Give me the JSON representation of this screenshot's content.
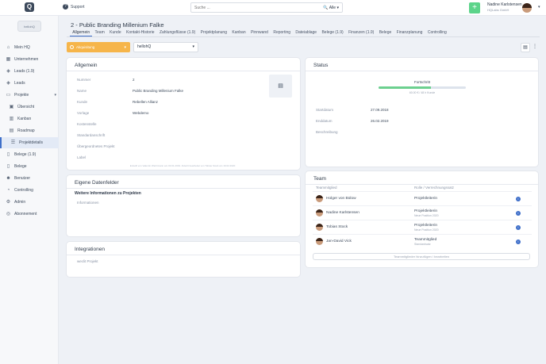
{
  "app": {
    "logo_letter": "Q",
    "workspace_label": "hellohQ"
  },
  "topbar": {
    "support_label": "Support",
    "search_placeholder": "Suche ...",
    "search_scope": "Alle",
    "add_symbol": "+",
    "user_name": "Nadine Karlstensen",
    "user_org": "HQLabs GmbH"
  },
  "sidebar": {
    "items": [
      {
        "label": "Mein HQ",
        "icon": "home-icon"
      },
      {
        "label": "Unternehmen",
        "icon": "building-icon"
      },
      {
        "label": "Leads (1.9)",
        "icon": "tag-icon"
      },
      {
        "label": "Leads",
        "icon": "tag-icon"
      },
      {
        "label": "Projekte",
        "icon": "folder-icon"
      },
      {
        "label": "Übersicht",
        "icon": "overview-icon"
      },
      {
        "label": "Kanban",
        "icon": "kanban-icon"
      },
      {
        "label": "Roadmap",
        "icon": "roadmap-icon"
      },
      {
        "label": "Projektdetails",
        "icon": "details-icon"
      },
      {
        "label": "Belege (1.9)",
        "icon": "receipt-icon"
      },
      {
        "label": "Belege",
        "icon": "receipt-icon"
      },
      {
        "label": "Benutzer",
        "icon": "users-icon"
      },
      {
        "label": "Controlling",
        "icon": "chart-icon"
      },
      {
        "label": "Admin",
        "icon": "gear-icon"
      },
      {
        "label": "Abonnement",
        "icon": "subscription-icon"
      }
    ]
  },
  "page": {
    "title": "2 - Public Branding Millenium Falke",
    "tabs": [
      "Allgemein",
      "Team",
      "Kunde",
      "Kontakt-Historie",
      "Zahlungsflüsse (1.9)",
      "Projektplanung",
      "Kanban",
      "Pinnwand",
      "Reporting",
      "Dateiablage",
      "Belege (1.9)",
      "Finanzen (1.9)",
      "Belege",
      "Finanzplanung",
      "Controlling"
    ],
    "active_tab": "Allgemein",
    "phase_button": "Akquisitung",
    "template_select": "hellohQ"
  },
  "general": {
    "title": "Allgemein",
    "fields": [
      {
        "label": "Nummer",
        "value": "2"
      },
      {
        "label": "Name",
        "value": "Public Branding Millenium Falke"
      },
      {
        "label": "Kunde",
        "value": "Rebellen Allianz"
      },
      {
        "label": "Vorlage",
        "value": "Webdemo"
      },
      {
        "label": "Kostenstelle",
        "value": ""
      },
      {
        "label": "Standardanschrift",
        "value": ""
      },
      {
        "label": "Übergeordnetes Projekt",
        "value": ""
      },
      {
        "label": "Label",
        "value": ""
      }
    ],
    "footnote": "Erstellt von Valentin Wiehrmann am 03.01.2019. Zuletzt bearbeitet von Tobias Stock am 19.02.2020"
  },
  "status": {
    "title": "Status",
    "progress_label": "Fortschritt",
    "progress_percent": 60,
    "progress_sub": "60.00 € / 48 h Kunde",
    "fields": [
      {
        "label": "Startdatum",
        "value": "27.09.2018"
      },
      {
        "label": "Enddatum",
        "value": "26.02.2019"
      },
      {
        "label": "Beschreibung",
        "value": ""
      }
    ]
  },
  "custom_fields": {
    "title": "Eigene Datenfelder",
    "subtitle": "Weitere Informationen zu Projekten",
    "field_label": "Informationen"
  },
  "team": {
    "title": "Team",
    "col_member": "Teammitglied",
    "col_role": "Rolle / Verrechnungssatz",
    "members": [
      {
        "name": "Holger von Bülow",
        "role": "Projektleiterin",
        "sub": ""
      },
      {
        "name": "Nadine Karlstensen",
        "role": "Projektleiterin",
        "sub": "Neue Position 2020"
      },
      {
        "name": "Tobias Stock",
        "role": "Projektleiterin",
        "sub": "Neue Position 2020"
      },
      {
        "name": "Jan-David Vick",
        "role": "Teammitglied",
        "sub": "Standardsatz"
      }
    ],
    "edit_button": "Teammitglieder hinzufügen / bearbeiten"
  },
  "integrations": {
    "title": "Integrationen",
    "item": "weclit Projekt"
  },
  "colors": {
    "accent": "#3f6fc9",
    "phase": "#f6b54a",
    "success": "#5cd48a"
  }
}
